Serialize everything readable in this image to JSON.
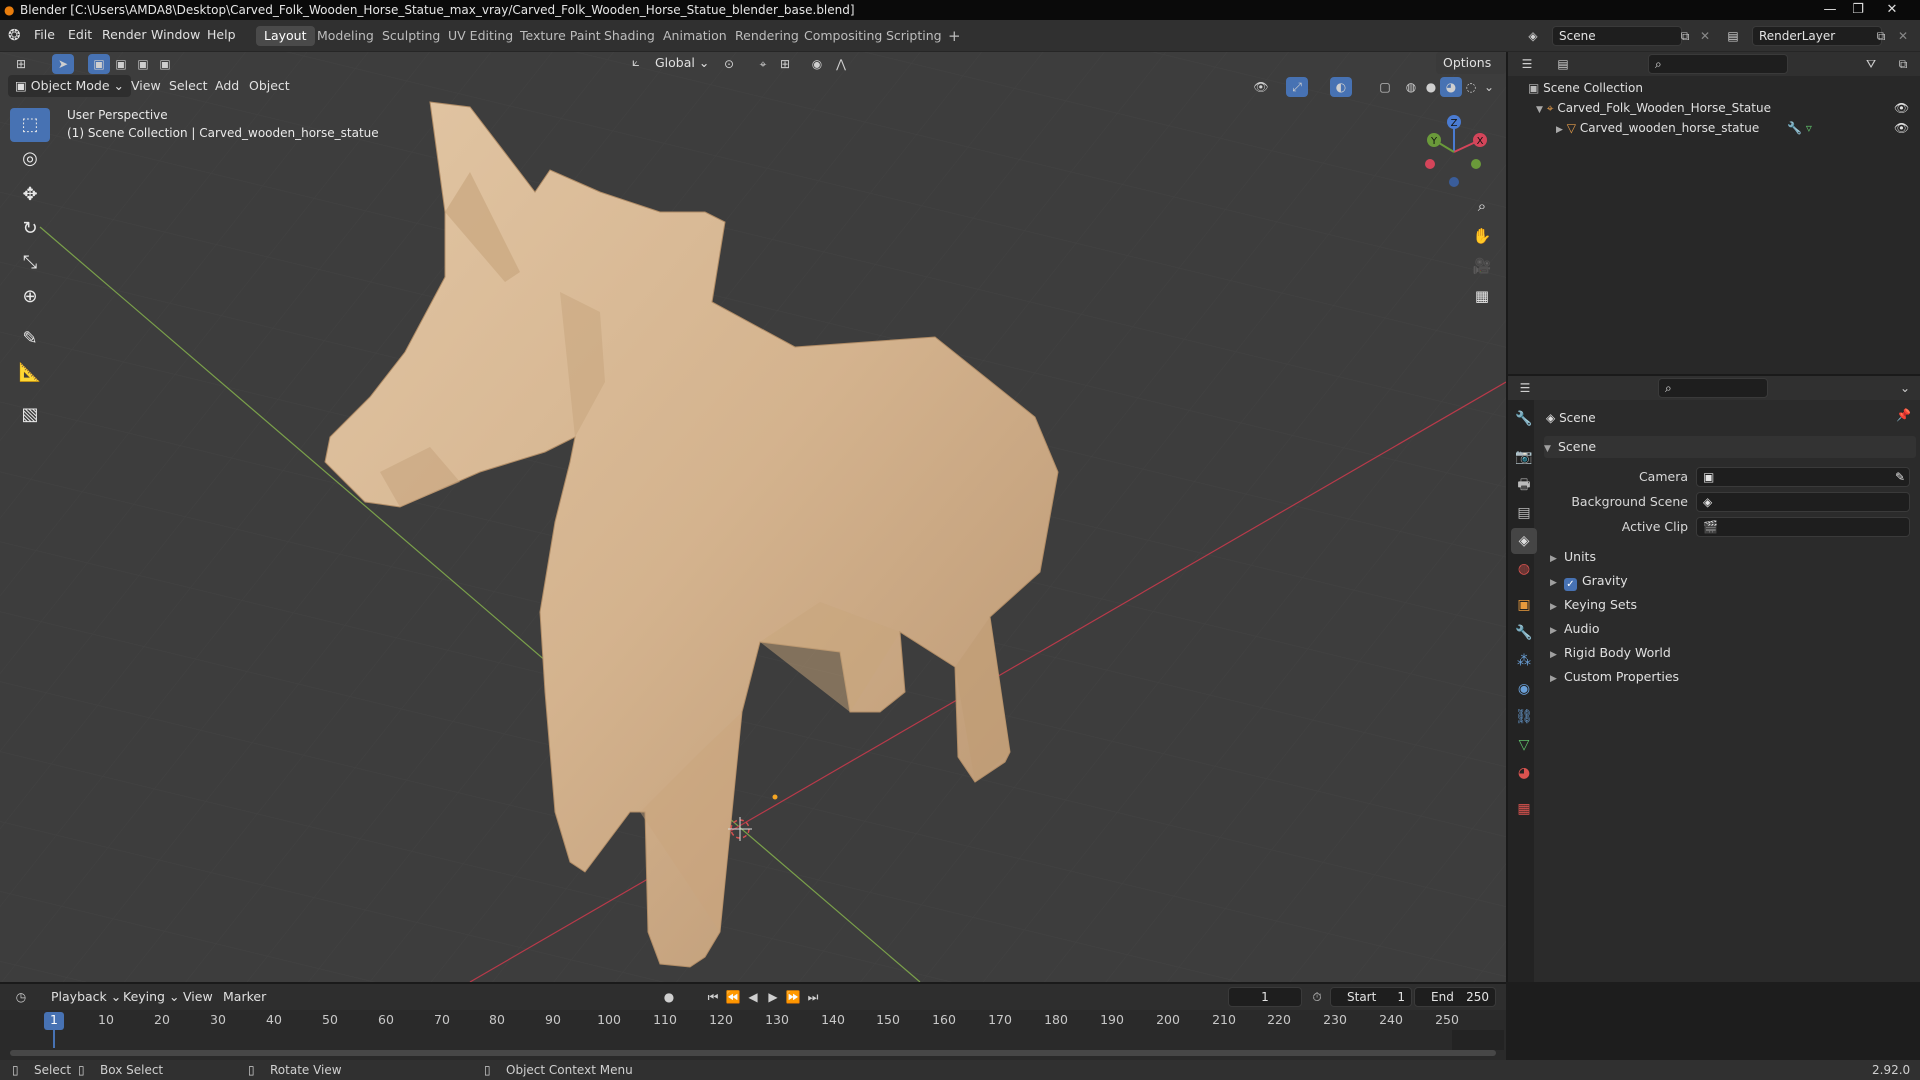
{
  "window": {
    "title": "Blender [C:\\Users\\AMDA8\\Desktop\\Carved_Folk_Wooden_Horse_Statue_max_vray/Carved_Folk_Wooden_Horse_Statue_blender_base.blend]",
    "controls": [
      "—",
      "❐",
      "✕"
    ]
  },
  "menu": {
    "items": [
      "File",
      "Edit",
      "Render",
      "Window",
      "Help"
    ],
    "workspaces": [
      "Layout",
      "Modeling",
      "Sculpting",
      "UV Editing",
      "Texture Paint",
      "Shading",
      "Animation",
      "Rendering",
      "Compositing",
      "Scripting"
    ],
    "active_workspace": "Layout",
    "add_workspace": "+",
    "scene_name": "Scene",
    "view_layer": "RenderLayer"
  },
  "viewport": {
    "mode": "Object Mode",
    "menus": [
      "View",
      "Select",
      "Add",
      "Object"
    ],
    "transform_orientation": "Global",
    "options_label": "Options",
    "overlay_title": "User Perspective",
    "overlay_subtitle": "(1) Scene Collection | Carved_wooden_horse_statue",
    "gizmo_axes": [
      "X",
      "Y",
      "Z"
    ],
    "tools": [
      "select-box-icon",
      "cursor-icon",
      "move-icon",
      "rotate-icon",
      "scale-icon",
      "transform-icon",
      "annotate-icon",
      "measure-icon",
      "add-cube-icon"
    ],
    "nav_buttons": [
      "zoom-icon",
      "pan-hand-icon",
      "camera-view-icon",
      "ortho-grid-icon"
    ],
    "colors": {
      "background": "#3d3d3d",
      "grid_x": "#b83a4a",
      "grid_y": "#7aa04a",
      "wood": "#d6b896"
    }
  },
  "outliner": {
    "root": "Scene Collection",
    "items": [
      {
        "name": "Carved_Folk_Wooden_Horse_Statue",
        "icon": "empty-icon"
      },
      {
        "name": "Carved_wooden_horse_statue",
        "icon": "mesh-icon"
      }
    ]
  },
  "properties": {
    "context_label": "Scene",
    "panel_title": "Scene",
    "fields": [
      {
        "label": "Camera",
        "value": ""
      },
      {
        "label": "Background Scene",
        "value": ""
      },
      {
        "label": "Active Clip",
        "value": ""
      }
    ],
    "sections": [
      "Units",
      "Gravity",
      "Keying Sets",
      "Audio",
      "Rigid Body World",
      "Custom Properties"
    ],
    "gravity_checked": true,
    "tabs": [
      "tool-icon",
      "render-icon",
      "output-icon",
      "view-layer-icon",
      "scene-icon",
      "world-icon",
      "object-icon",
      "modifier-icon",
      "particles-icon",
      "physics-icon",
      "constraints-icon",
      "data-icon",
      "material-icon",
      "texture-icon"
    ]
  },
  "timeline": {
    "menus": [
      "Playback",
      "Keying",
      "View",
      "Marker"
    ],
    "current_frame": "1",
    "start_label": "Start",
    "start": "1",
    "end_label": "End",
    "end": "250",
    "ticks": [
      "1",
      "10",
      "20",
      "30",
      "40",
      "50",
      "60",
      "70",
      "80",
      "90",
      "100",
      "110",
      "120",
      "130",
      "140",
      "150",
      "160",
      "170",
      "180",
      "190",
      "200",
      "210",
      "220",
      "230",
      "240",
      "250"
    ]
  },
  "status": {
    "items": [
      "Select",
      "Box Select",
      "Rotate View",
      "Object Context Menu"
    ],
    "version": "2.92.0"
  }
}
